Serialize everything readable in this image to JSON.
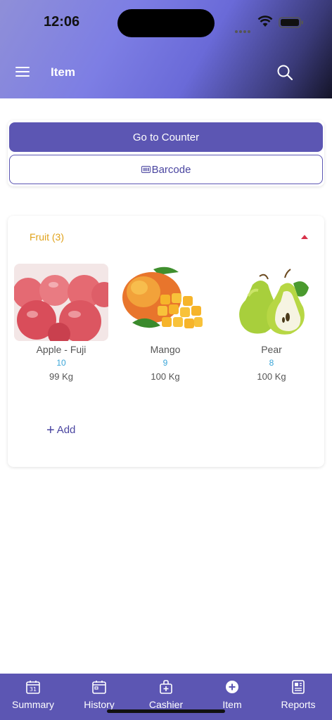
{
  "status": {
    "time": "12:06"
  },
  "header": {
    "title": "Item"
  },
  "actions": {
    "counter_label": "Go to Counter",
    "barcode_label": "Barcode"
  },
  "category": {
    "title": "Fruit (3)",
    "items": [
      {
        "name": "Apple - Fuji",
        "qty": "10",
        "stock": "99 Kg"
      },
      {
        "name": "Mango",
        "qty": "9",
        "stock": "100 Kg"
      },
      {
        "name": "Pear",
        "qty": "8",
        "stock": "100 Kg"
      }
    ],
    "add_label": "Add"
  },
  "nav": {
    "items": [
      {
        "label": "Summary",
        "icon": "calendar-icon"
      },
      {
        "label": "History",
        "icon": "history-calendar-icon"
      },
      {
        "label": "Cashier",
        "icon": "cash-register-icon"
      },
      {
        "label": "Item",
        "icon": "plus-circle-icon"
      },
      {
        "label": "Reports",
        "icon": "report-icon"
      }
    ]
  },
  "colors": {
    "accent": "#5c56b3",
    "category": "#e0a21a",
    "qty": "#3aa5d8",
    "caret": "#d8324a"
  }
}
